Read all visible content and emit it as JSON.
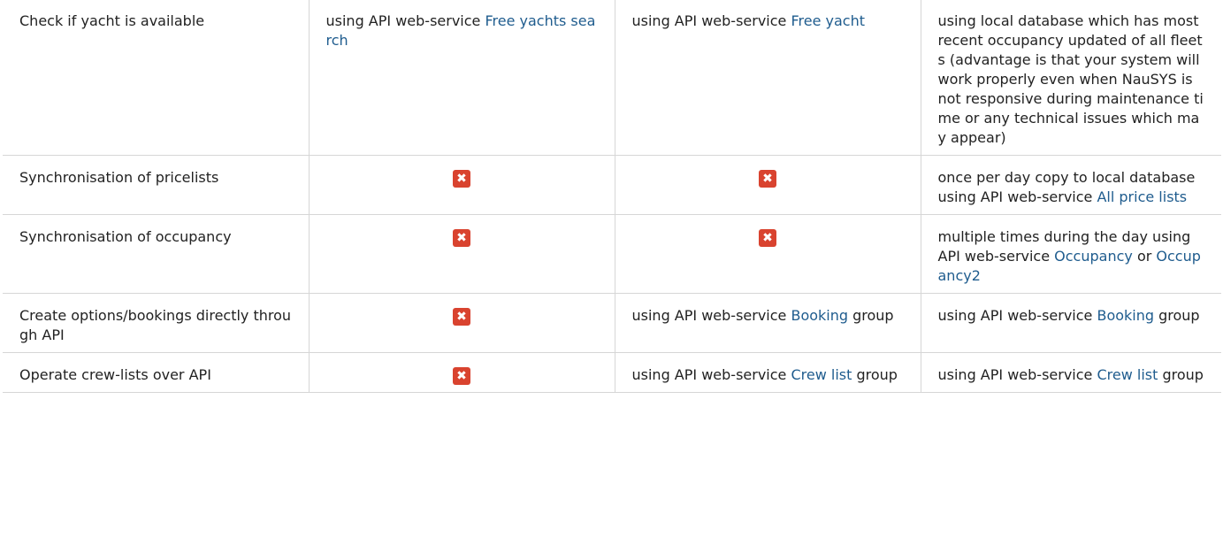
{
  "colors": {
    "link": "#1f5c8e",
    "no_mark": "#d9432f",
    "border": "#d6d6d6",
    "text": "#222222"
  },
  "rows": [
    {
      "feature": "Check if yacht is available",
      "col1": {
        "prefix": "using API web-service ",
        "link": "Free yachts search"
      },
      "col2": {
        "prefix": "using API web-service ",
        "link": "Free yacht"
      },
      "col3": {
        "text": "using local database which has most recent occupancy updated of all fleets (advantage is that your system will work properly even when NauSYS is not responsive during maintenance time or any technical issues which may appear)"
      }
    },
    {
      "feature": "Synchronisation of pricelists",
      "col1": {
        "icon": "x-mark-icon"
      },
      "col2": {
        "icon": "x-mark-icon"
      },
      "col3": {
        "prefix": "once per day copy to local database using API web-service ",
        "link": "All price lists"
      }
    },
    {
      "feature": "Synchronisation of occupancy",
      "col1": {
        "icon": "x-mark-icon"
      },
      "col2": {
        "icon": "x-mark-icon"
      },
      "col3": {
        "prefix": "multiple times during the day using API web-service ",
        "link": "Occupancy",
        "middle": " or ",
        "link2": "Occupancy2"
      }
    },
    {
      "feature": "Create options/bookings directly through API",
      "col1": {
        "icon": "x-mark-icon"
      },
      "col2": {
        "prefix": "using API web-service ",
        "link": "Booking",
        "suffix": " group"
      },
      "col3": {
        "prefix": "using API web-service ",
        "link": "Booking",
        "suffix": " group"
      }
    },
    {
      "feature": "Operate crew-lists over API",
      "col1": {
        "icon": "x-mark-icon"
      },
      "col2": {
        "prefix": "using API web-service ",
        "link": "Crew list",
        "suffix": " group"
      },
      "col3": {
        "prefix": "using API web-service ",
        "link": "Crew list",
        "suffix": " group"
      }
    }
  ]
}
